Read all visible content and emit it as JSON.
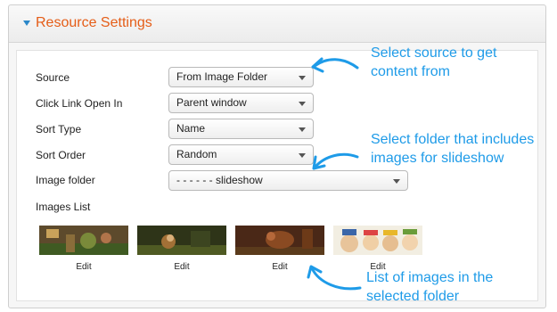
{
  "panel": {
    "title": "Resource Settings"
  },
  "form": {
    "fields": [
      {
        "label": "Source",
        "value": "From Image Folder"
      },
      {
        "label": "Click Link Open In",
        "value": "Parent window"
      },
      {
        "label": "Sort Type",
        "value": "Name"
      },
      {
        "label": "Sort Order",
        "value": "Random"
      },
      {
        "label": "Image folder",
        "value": "- - - - - - slideshow"
      }
    ],
    "images_list_label": "Images List",
    "images": [
      {
        "edit_label": "Edit"
      },
      {
        "edit_label": "Edit"
      },
      {
        "edit_label": "Edit"
      },
      {
        "edit_label": "Edit"
      }
    ]
  },
  "annotations": {
    "source": "Select source to get\ncontent from",
    "folder": "Select folder that includes\nimages for slideshow",
    "list": "List of images in the\nselected folder"
  },
  "colors": {
    "title": "#e55d17",
    "annotation": "#1e9be8",
    "caret": "#2a87c9"
  }
}
